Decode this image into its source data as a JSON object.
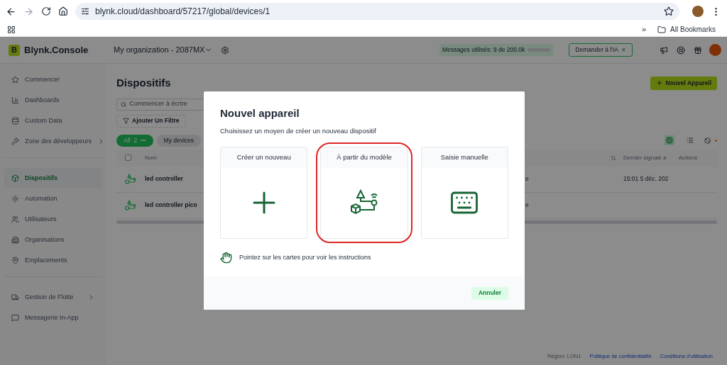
{
  "browser": {
    "url": "blynk.cloud/dashboard/57217/global/devices/1",
    "bookmarks_overflow": "»",
    "bookmarks_folder": "All Bookmarks"
  },
  "header": {
    "logo_letter": "B",
    "brand": "Blynk.Console",
    "organization": "My organization - 2087MX",
    "messages": "Messages utilisés: 9 de 200.0k",
    "messages_meter": {
      "level": 0.0
    },
    "ai_button": "Demander à l'IA",
    "ai_glyph": "✕"
  },
  "sidebar": {
    "groups": [
      [
        {
          "label": "Commencer",
          "selected": false,
          "expandable": false
        },
        {
          "label": "Dashboards",
          "selected": false,
          "expandable": false
        },
        {
          "label": "Custom Data",
          "selected": false,
          "expandable": false
        },
        {
          "label": "Zone des développeurs",
          "selected": false,
          "expandable": true
        }
      ],
      [
        {
          "label": "Dispositifs",
          "selected": true,
          "expandable": false
        },
        {
          "label": "Automation",
          "selected": false,
          "expandable": false
        },
        {
          "label": "Utilisateurs",
          "selected": false,
          "expandable": false
        },
        {
          "label": "Organisations",
          "selected": false,
          "expandable": false
        },
        {
          "label": "Emplacements",
          "selected": false,
          "expandable": false
        }
      ],
      [
        {
          "label": "Gestion de Flotte",
          "selected": false,
          "expandable": true
        },
        {
          "label": "Messagerie In-App",
          "selected": false,
          "expandable": false
        }
      ]
    ]
  },
  "page": {
    "title": "Dispositifs",
    "new_button": "Nouvel Appareil",
    "search_placeholder": "Commencer à écrire",
    "filter_button": "Ajouter Un Filtre",
    "filters": [
      {
        "label": "All",
        "count": "2",
        "menu_glyph": "•••",
        "selected": true
      },
      {
        "label": "My devices",
        "selected": false
      }
    ],
    "table": {
      "select_all_checked": false,
      "columns": [
        "Nom",
        "Dernier signalé à",
        "Actions"
      ],
      "rows": [
        {
          "name": "led controller",
          "column_3": "e",
          "last_reported": "15:01 5 déc. 202"
        },
        {
          "name": "led controller pico",
          "column_3": "e"
        }
      ]
    }
  },
  "footer": {
    "region": "Région: LON1",
    "links": [
      "Politique de confidentialité",
      "Conditions d'utilisation"
    ]
  },
  "dialog": {
    "title": "Nouvel appareil",
    "subtitle": "Choisissez un moyen de créer un nouveau dispositif",
    "cards": [
      {
        "label": "Créer un nouveau",
        "kind": "plus",
        "highlighted": false
      },
      {
        "label": "À partir du modèle",
        "kind": "template",
        "highlighted": true
      },
      {
        "label": "Saisie manuelle",
        "kind": "keyboard",
        "highlighted": false
      }
    ],
    "hint": "Pointez sur les cartes pour voir les instructions",
    "cancel": "Annuler"
  }
}
